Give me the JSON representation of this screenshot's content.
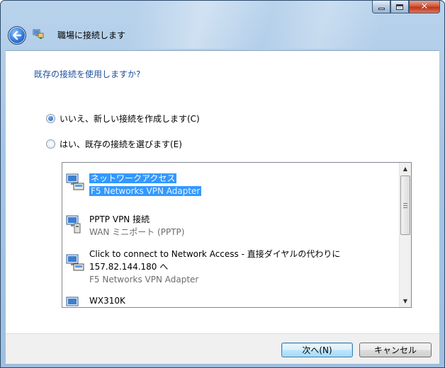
{
  "window": {
    "title": "職場に接続します"
  },
  "content": {
    "question": "既存の接続を使用しますか?",
    "options": [
      {
        "label": "いいえ、新しい接続を作成します(C)",
        "selected": true
      },
      {
        "label": "はい、既存の接続を選びます(E)",
        "selected": false
      }
    ],
    "connections": [
      {
        "name": "ネットワークアクセス",
        "detail": "F5 Networks VPN Adapter",
        "selected": true
      },
      {
        "name": "PPTP VPN 接続",
        "detail": "WAN ミニポート (PPTP)",
        "selected": false
      },
      {
        "name": "Click to connect to Network Access - 直接ダイヤルの代わりに",
        "name2": "157.82.144.180 へ",
        "detail": "F5 Networks VPN Adapter",
        "selected": false
      },
      {
        "name": "WX310K",
        "detail": "",
        "selected": false
      }
    ]
  },
  "footer": {
    "next_label": "次へ(N)",
    "cancel_label": "キャンセル"
  },
  "colors": {
    "accent": "#1e4f9c",
    "selection": "#3399ff"
  },
  "icons": [
    "back-arrow-icon",
    "network-connection-icon",
    "network-adapter-icon"
  ]
}
